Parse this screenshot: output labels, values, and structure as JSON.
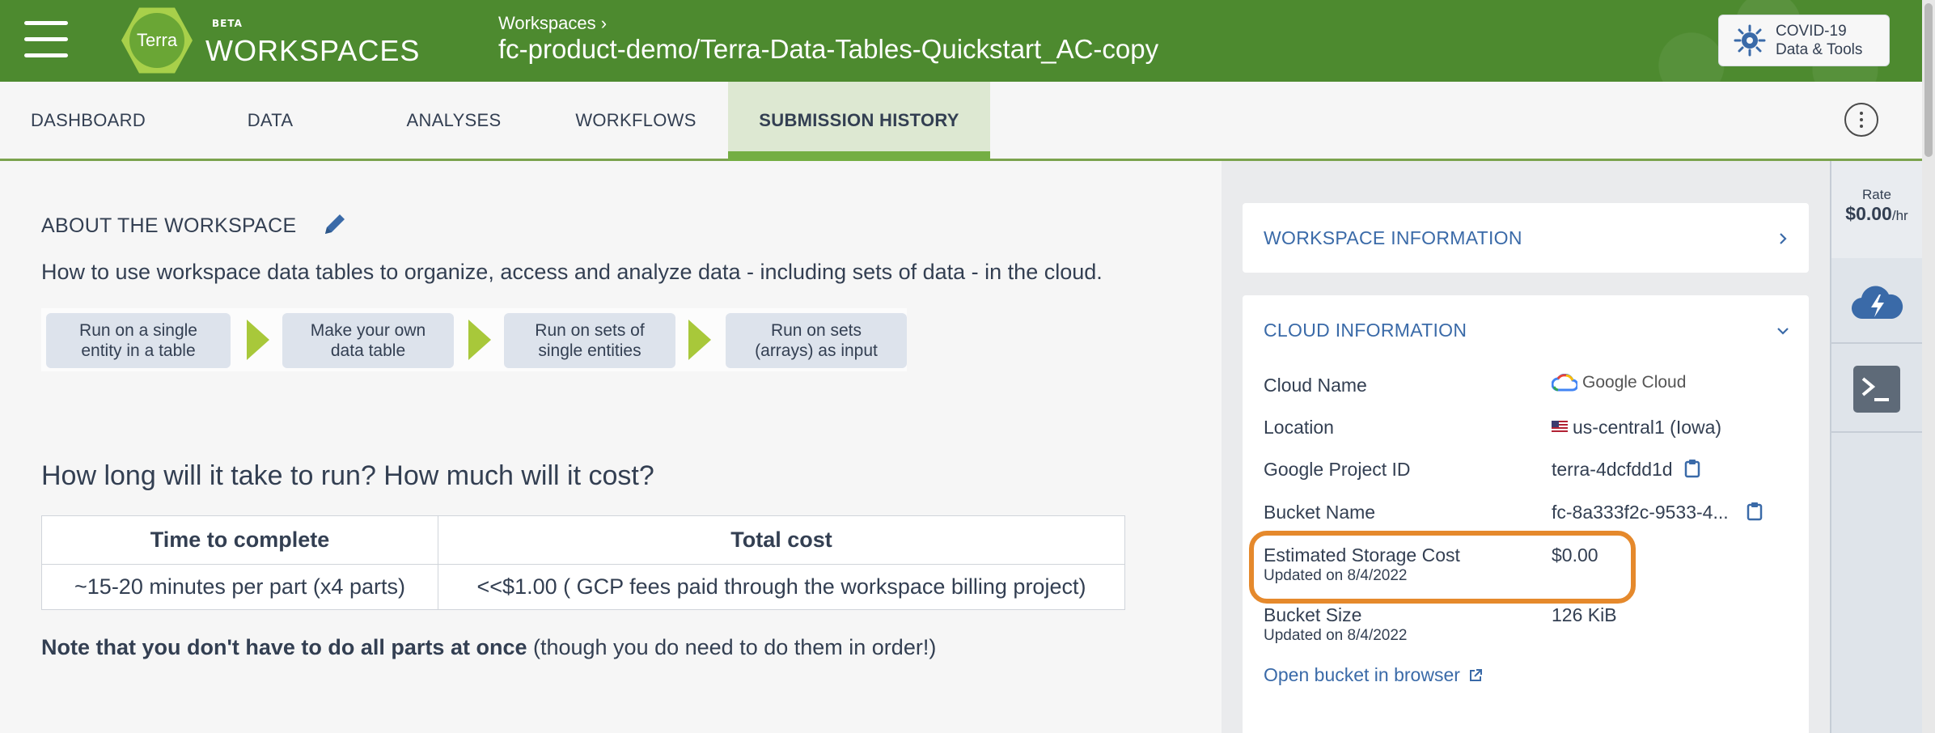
{
  "app": {
    "beta": "BETA",
    "brand": "WORKSPACES",
    "logo_text": "Terra"
  },
  "header": {
    "breadcrumb": "Workspaces ›",
    "workspace_title": "fc-product-demo/Terra-Data-Tables-Quickstart_AC-copy",
    "covid_line1": "COVID-19",
    "covid_line2": "Data & Tools"
  },
  "tabs": [
    {
      "label": "DASHBOARD"
    },
    {
      "label": "DATA"
    },
    {
      "label": "ANALYSES"
    },
    {
      "label": "WORKFLOWS"
    },
    {
      "label": "SUBMISSION HISTORY"
    }
  ],
  "about": {
    "title": "ABOUT THE WORKSPACE",
    "description": "How to use workspace data tables to organize, access and analyze data - including sets of data - in the cloud.",
    "steps": [
      {
        "line1": "Run on a single",
        "line2": "entity in a table"
      },
      {
        "line1": "Make your own",
        "line2": "data table"
      },
      {
        "line1": "Run on sets of",
        "line2": "single entities"
      },
      {
        "line1": "Run on sets",
        "line2": "(arrays) as input"
      }
    ],
    "question": "How long will it take to run? How much will it cost?",
    "table": {
      "headers": [
        "Time to complete",
        "Total cost"
      ],
      "row": [
        "~15-20 minutes per part (x4 parts)",
        "<<$1.00 ( GCP fees paid through the workspace billing project)"
      ]
    },
    "note_bold": "Note that you don't have to do all parts at once",
    "note_rest": " (though you do need to do them in order!)"
  },
  "right": {
    "workspace_info_title": "WORKSPACE INFORMATION",
    "cloud_info_title": "CLOUD INFORMATION",
    "rows": {
      "cloud_name_label": "Cloud Name",
      "cloud_name_value": "Google Cloud",
      "location_label": "Location",
      "location_value": "us-central1 (Iowa)",
      "project_label": "Google Project ID",
      "project_value": "terra-4dcfdd1d",
      "bucket_label": "Bucket Name",
      "bucket_value": "fc-8a333f2c-9533-4...",
      "storage_label": "Estimated Storage Cost",
      "storage_sub": "Updated on 8/4/2022",
      "storage_value": "$0.00",
      "size_label": "Bucket Size",
      "size_sub": "Updated on 8/4/2022",
      "size_value": "126 KiB"
    },
    "open_bucket": "Open bucket in browser"
  },
  "rail": {
    "rate_label": "Rate",
    "rate_value": "$0.00",
    "rate_unit": "/hr"
  },
  "colors": {
    "header_green": "#4d8a2f",
    "link_blue": "#3a6aa8",
    "highlight_orange": "#e5892c"
  }
}
